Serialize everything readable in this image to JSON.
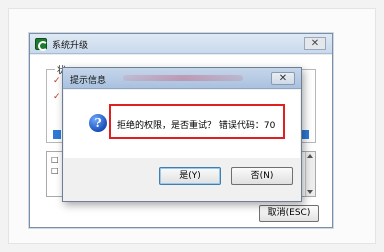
{
  "main_window": {
    "title": "系统升级",
    "close_symbol": "✕",
    "group_label": "状",
    "checks": [
      "✓",
      "✓"
    ],
    "list_marks": [
      "□",
      "□"
    ],
    "cancel_label": "取消(ESC)"
  },
  "dialog": {
    "title": "提示信息",
    "close_symbol": "✕",
    "icon_glyph": "?",
    "message": "拒绝的权限，是否重试？ 错误代码：70",
    "yes_label": "是(Y)",
    "no_label": "否(N)"
  },
  "colors": {
    "highlight": "#e02020",
    "accent": "#1c4fb8"
  },
  "icons": [
    "app-icon",
    "question-icon",
    "close-icon"
  ]
}
